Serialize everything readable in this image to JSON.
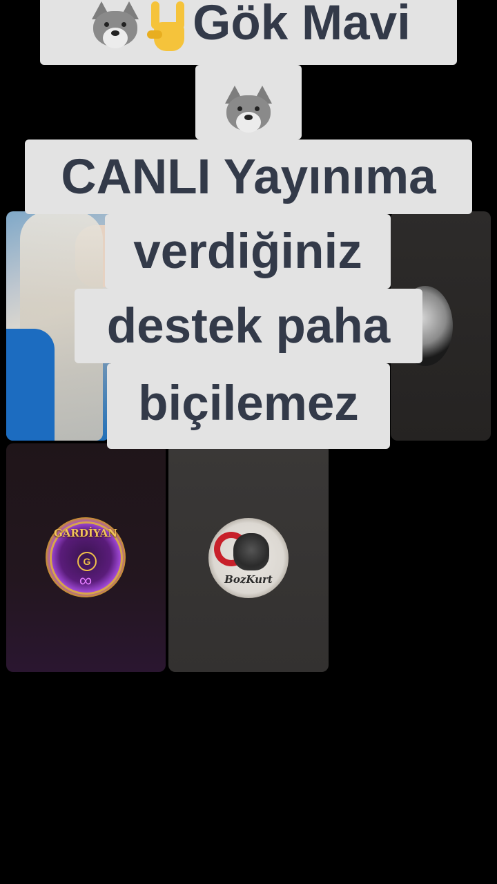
{
  "caption": {
    "line1_text": "Gök Mavi",
    "line3": "CANLI Yayınıma",
    "line4": "verdiğiniz",
    "line5": "destek paha",
    "line6": "biçilemez",
    "emoji_wolf": "wolf-face",
    "emoji_horns": "sign-of-the-horns",
    "text_color": "#333a49",
    "bg_color": "#e3e3e3"
  },
  "participants": [
    {
      "id": "host",
      "kind": "camera"
    },
    {
      "id": "guest-2",
      "kind": "avatar"
    },
    {
      "id": "gardiyan",
      "kind": "avatar",
      "badge_text": "GARDİYAN",
      "badge_mark": "G"
    },
    {
      "id": "bozkurt",
      "kind": "avatar",
      "badge_text": "BozKurt"
    }
  ]
}
